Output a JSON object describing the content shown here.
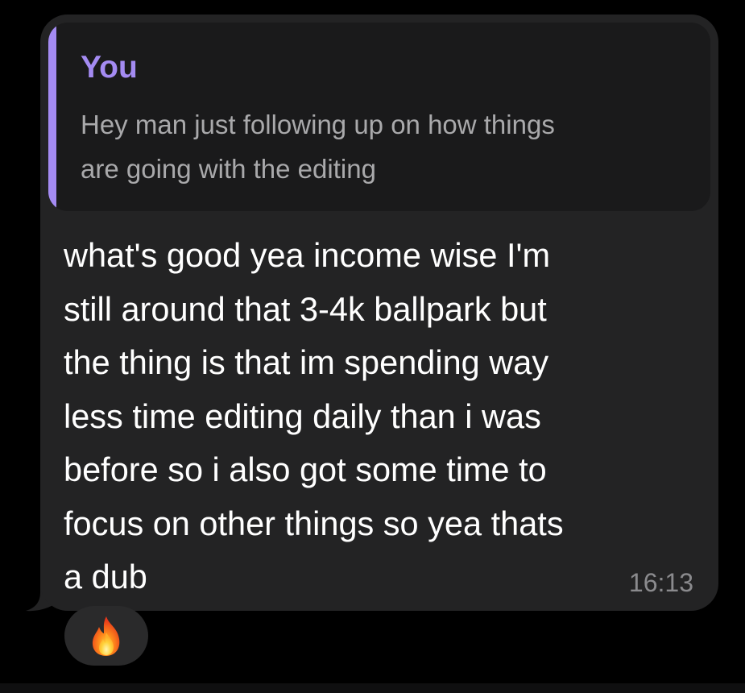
{
  "message": {
    "reply": {
      "author": "You",
      "text": "Hey man just following up on how things\nare going with the editing"
    },
    "text": "what's good yea income wise I'm\nstill around that 3-4k ballpark but\nthe thing is that im spending way\nless time editing daily than i was\nbefore so i also got some time to\nfocus on other things so yea thats\na dub",
    "time": "16:13",
    "reaction": "fire-emoji"
  },
  "colors": {
    "background": "#000000",
    "bubble": "#232324",
    "reply_background": "#1a1a1b",
    "accent": "#a48bf2",
    "text": "#ffffff",
    "secondary_text": "#a9a9ab",
    "timestamp": "#8a8a8d"
  }
}
